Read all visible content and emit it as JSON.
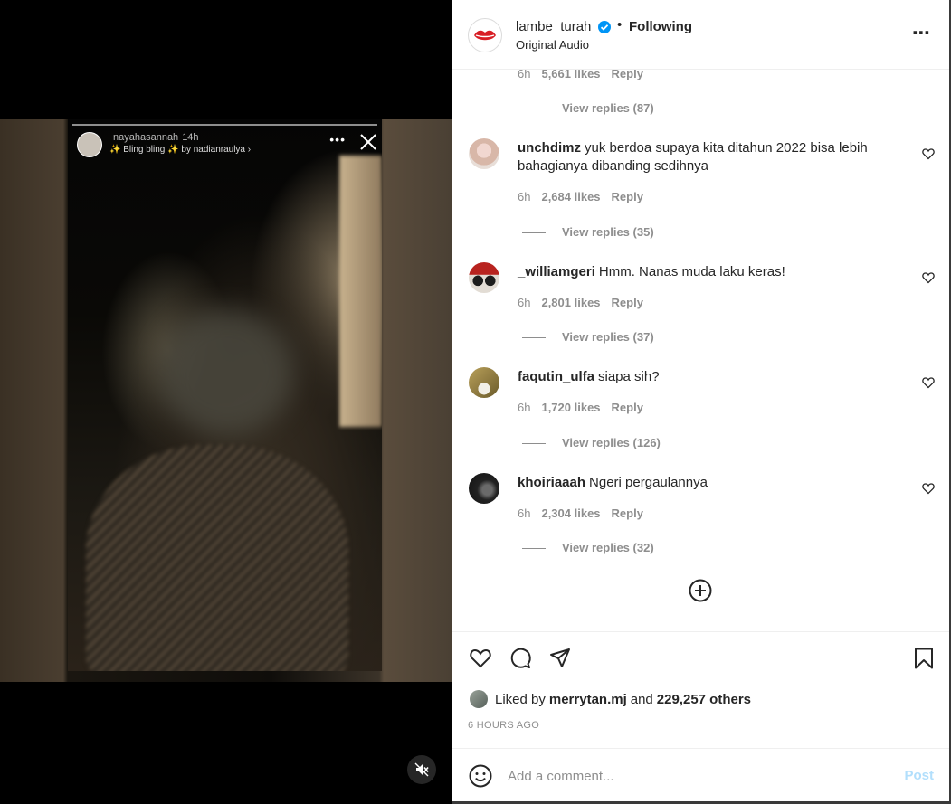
{
  "story": {
    "username": "nayahasannah",
    "time": "14h",
    "music": "✨ Bling bling ✨ by nadianraulya ›"
  },
  "header": {
    "username": "lambe_turah",
    "separator": "•",
    "follow_state": "Following",
    "audio": "Original Audio"
  },
  "comments": {
    "top_partial": {
      "time": "6h",
      "likes": "5,661 likes",
      "reply": "Reply",
      "view_replies": "View replies (87)"
    },
    "items": [
      {
        "username": "unchdimz",
        "text": "yuk berdoa supaya kita ditahun 2022 bisa lebih bahagianya dibanding sedihnya",
        "time": "6h",
        "likes": "2,684 likes",
        "reply": "Reply",
        "view_replies": "View replies (35)"
      },
      {
        "username": "_williamgeri",
        "text": "Hmm. Nanas muda laku keras!",
        "time": "6h",
        "likes": "2,801 likes",
        "reply": "Reply",
        "view_replies": "View replies (37)"
      },
      {
        "username": "faqutin_ulfa",
        "text": "siapa sih?",
        "time": "6h",
        "likes": "1,720 likes",
        "reply": "Reply",
        "view_replies": "View replies (126)"
      },
      {
        "username": "khoiriaaah",
        "text": "Ngeri pergaulannya",
        "time": "6h",
        "likes": "2,304 likes",
        "reply": "Reply",
        "view_replies": "View replies (32)"
      }
    ]
  },
  "likes": {
    "prefix": "Liked by",
    "user": "merrytan.mj",
    "conj": "and",
    "others": "229,257 others",
    "ago": "6 HOURS AGO"
  },
  "add_comment": {
    "placeholder": "Add a comment...",
    "post_label": "Post"
  },
  "colors": {
    "verified": "#0095f6",
    "post_disabled": "#b2dffc",
    "secondary_text": "#8e8e8e",
    "primary_text": "#262626"
  },
  "icons": [
    "close-icon",
    "more-icon",
    "mute-icon",
    "verified-icon",
    "heart-icon",
    "comment-icon",
    "share-icon",
    "bookmark-icon",
    "plus-circle-icon",
    "emoji-icon"
  ]
}
